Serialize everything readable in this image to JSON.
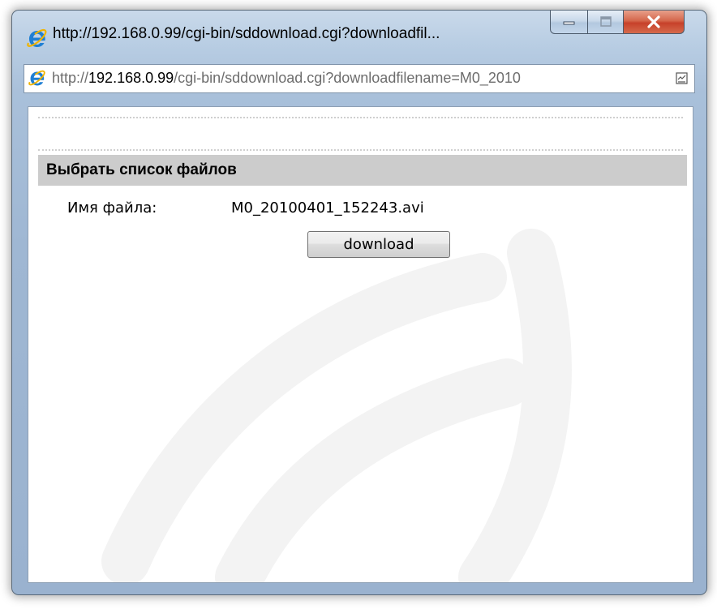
{
  "window": {
    "title": "http://192.168.0.99/cgi-bin/sddownload.cgi?downloadfil...",
    "caption_buttons": [
      "minimize",
      "maximize",
      "close"
    ]
  },
  "address": {
    "prefix": "http://",
    "host": "192.168.0.99",
    "path": "/cgi-bin/sddownload.cgi?downloadfilename=M0_2010"
  },
  "page": {
    "section_title": "Выбрать список файлов",
    "file_label": "Имя файла:",
    "file_name": "M0_20100401_152243.avi",
    "download_label": "download"
  },
  "icons": {
    "title": "ie-icon",
    "address": "ie-icon",
    "compat": "compatibility-view-icon",
    "min": "minimize-icon",
    "max": "maximize-icon",
    "close": "close-icon"
  },
  "colors": {
    "section_header_bg": "#cccccc",
    "close_button": "#c7412a",
    "frame": "#a9c0da"
  }
}
